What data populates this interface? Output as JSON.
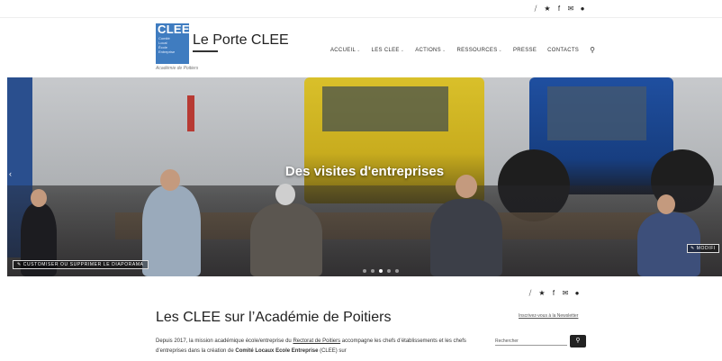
{
  "top_social": {
    "icons": [
      "rss-icon",
      "twitter-icon",
      "facebook-icon",
      "mail-icon",
      "github-icon"
    ],
    "glyphs": [
      "⧸",
      "★",
      "f",
      "✉",
      "●"
    ]
  },
  "header": {
    "logo_text": "CLEE",
    "logo_small_lines": [
      "Comité",
      "Local",
      "École",
      "Entreprise"
    ],
    "site_title": "Le Porte CLEE",
    "tagline": "Académie de Poitiers",
    "nav": [
      {
        "label": "ACCUEIL",
        "has_dropdown": true
      },
      {
        "label": "LES CLEE",
        "has_dropdown": true
      },
      {
        "label": "ACTIONS",
        "has_dropdown": true
      },
      {
        "label": "RESSOURCES",
        "has_dropdown": true
      },
      {
        "label": "PRESSE",
        "has_dropdown": false
      },
      {
        "label": "CONTACTS",
        "has_dropdown": false
      }
    ],
    "search_glyph": "⚲"
  },
  "hero": {
    "caption": "Des visites d'entreprises",
    "customize_label": "CUSTOMISER OU SUPPRIMER LE DIAPORAMA",
    "modify_label": "MODIFI",
    "slide_count": 5,
    "active_slide": 2
  },
  "main": {
    "heading": "Les CLEE sur l’Académie de Poitiers",
    "intro_part1": "Depuis 2017, la mission académique école/entreprise du ",
    "intro_link": "Rectorat de Poitiers",
    "intro_part2": " accompagne les chefs d’établissements et les chefs d’entreprises dans la création de ",
    "intro_bold": "Comité Locaux Ecole Entreprise",
    "intro_part3": " (CLEE) sur"
  },
  "sidebar": {
    "newsletter_link": "Inscrivez-vous à la Newsletter",
    "search_placeholder": "Rechercher",
    "search_button_glyph": "⚲"
  },
  "colors": {
    "logo_blue": "#3f7cc0",
    "text_dark": "#222222",
    "button_dark": "#222222"
  }
}
